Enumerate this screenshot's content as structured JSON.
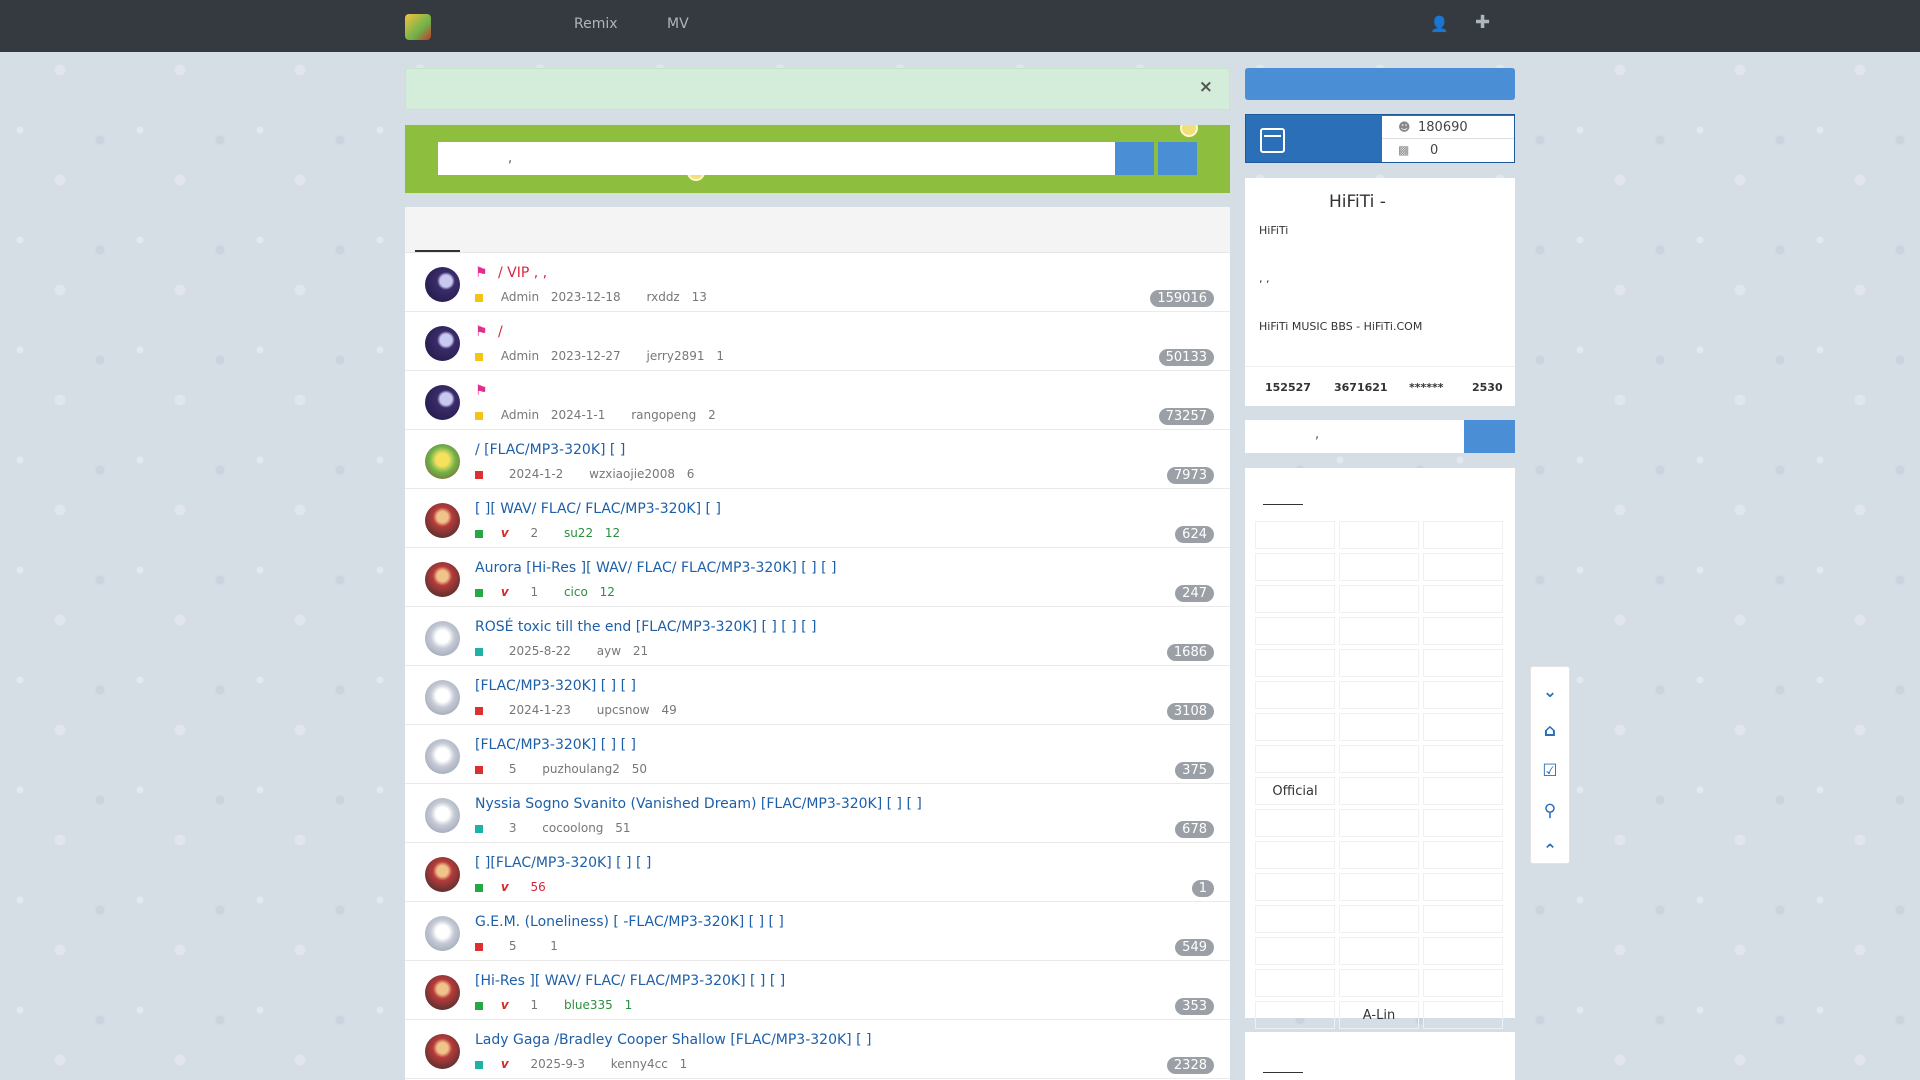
{
  "nav": {
    "links": [
      "Remix",
      "MV"
    ],
    "user_icon": "user-icon",
    "add_icon": "plus-icon"
  },
  "alert": {
    "close": "×"
  },
  "search": {
    "placeholder": ","
  },
  "threads": [
    {
      "avatar": "admin",
      "sticky": true,
      "flag": true,
      "title": "/ VIP            ,         ,",
      "dot": "yellow",
      "vip": false,
      "author": "Admin",
      "date": "2023-12-18",
      "last": "rxddz",
      "count": "13",
      "views": "159016"
    },
    {
      "avatar": "admin",
      "sticky": true,
      "flag": true,
      "title": "/",
      "dot": "yellow",
      "vip": false,
      "author": "Admin",
      "date": "2023-12-27",
      "last": "jerry2891",
      "count": "1",
      "views": "50133"
    },
    {
      "avatar": "admin",
      "sticky": true,
      "flag": true,
      "title": "",
      "dot": "yellow",
      "vip": false,
      "author": "Admin",
      "date": "2024-1-1",
      "last": "rangopeng",
      "count": "2",
      "views": "73257"
    },
    {
      "avatar": "user-c",
      "sticky": false,
      "flag": false,
      "title": "/                [FLAC/MP3-320K] [        ]",
      "dot": "red",
      "vip": false,
      "author": "",
      "date": "2024-1-2",
      "last": "wzxiaojie2008",
      "count": "6",
      "views": "7973"
    },
    {
      "avatar": "user-a",
      "sticky": false,
      "flag": false,
      "title": "[            ][        WAV/        FLAC/    FLAC/MP3-320K] [        ]",
      "dot": "green",
      "vip": true,
      "author": "",
      "date": "2",
      "last": "su22",
      "count": "12",
      "views": "624",
      "green": true
    },
    {
      "avatar": "user-a",
      "sticky": false,
      "flag": false,
      "title": "Aurora            [Hi-Res                        ][        WAV/        FLAC/    FLAC/MP3-320K] [        ] [        ]",
      "dot": "green",
      "vip": true,
      "author": "",
      "date": "1",
      "last": "cico",
      "count": "12",
      "views": "247",
      "green": true
    },
    {
      "avatar": "user-b",
      "sticky": false,
      "flag": false,
      "title": "ROSÉ  toxic till the end  [FLAC/MP3-320K] [        ] [        ] [        ]",
      "dot": "teal",
      "vip": false,
      "author": "",
      "date": "2025-8-22",
      "last": "ayw",
      "count": "21",
      "views": "1686"
    },
    {
      "avatar": "user-b",
      "sticky": false,
      "flag": false,
      "title": "[FLAC/MP3-320K] [        ] [        ]",
      "dot": "red",
      "vip": false,
      "author": "",
      "date": "2024-1-23",
      "last": "upcsnow",
      "count": "49",
      "views": "3108"
    },
    {
      "avatar": "user-b",
      "sticky": false,
      "flag": false,
      "title": "[FLAC/MP3-320K] [        ] [        ]",
      "dot": "red",
      "vip": false,
      "author": "",
      "date": "5",
      "last": "puzhoulang2",
      "count": "50",
      "views": "375"
    },
    {
      "avatar": "user-b",
      "sticky": false,
      "flag": false,
      "title": "Nyssia  Sogno Svanito (Vanished Dream)  [FLAC/MP3-320K] [        ] [        ]",
      "dot": "teal",
      "vip": false,
      "author": "",
      "date": "3",
      "last": "cocoolong",
      "count": "51",
      "views": "678"
    },
    {
      "avatar": "user-a",
      "sticky": false,
      "flag": false,
      "title": "[            ][FLAC/MP3-320K] [        ] [        ]",
      "dot": "green",
      "vip": true,
      "author": "",
      "date": "56",
      "last": "",
      "count": "",
      "views": "1",
      "redcount": true
    },
    {
      "avatar": "user-b",
      "sticky": false,
      "flag": false,
      "title": "G.E.M.            (Loneliness)   [     -FLAC/MP3-320K] [        ] [        ]",
      "dot": "red",
      "vip": false,
      "author": "",
      "date": "5",
      "last": "",
      "count": "1",
      "views": "549"
    },
    {
      "avatar": "user-a",
      "sticky": false,
      "flag": false,
      "title": "[Hi-Res                        ][        WAV/        FLAC/    FLAC/MP3-320K] [        ] [        ]",
      "dot": "green",
      "vip": true,
      "author": "",
      "date": "1",
      "last": "blue335",
      "count": "1",
      "views": "353",
      "green": true
    },
    {
      "avatar": "user-a",
      "sticky": false,
      "flag": false,
      "title": "Lady Gaga /Bradley Cooper   Shallow   [FLAC/MP3-320K] [        ]",
      "dot": "teal",
      "vip": true,
      "author": "",
      "date": "2025-9-3",
      "last": "kenny4cc",
      "count": "1",
      "views": "2328"
    }
  ],
  "stats": {
    "users": "180690",
    "online": "0"
  },
  "info": {
    "title": "HiFiTi -",
    "line1": "HiFiTi",
    "line2": ",                                   ,",
    "line3": "HiFiTi MUSIC BBS - HiFiTi.COM",
    "s1": "152527",
    "s2": "3671621",
    "s3": "******",
    "s4": "2530"
  },
  "side_search": {
    "text": ","
  },
  "tags": [
    "",
    "",
    "",
    "",
    "",
    "",
    "",
    "",
    "",
    "",
    "",
    "",
    "",
    "",
    "",
    "",
    "",
    "",
    "",
    "",
    "",
    "",
    "",
    "",
    "Official",
    "",
    "",
    "",
    "",
    "",
    "",
    "",
    "",
    "",
    "",
    "",
    "",
    "",
    "",
    "",
    "",
    "",
    "",
    "",
    "",
    "",
    "A-Lin",
    ""
  ],
  "float_tools": [
    "chevron-down-icon",
    "home-icon",
    "calendar-check-icon",
    "search-icon",
    "chevron-up-icon"
  ]
}
